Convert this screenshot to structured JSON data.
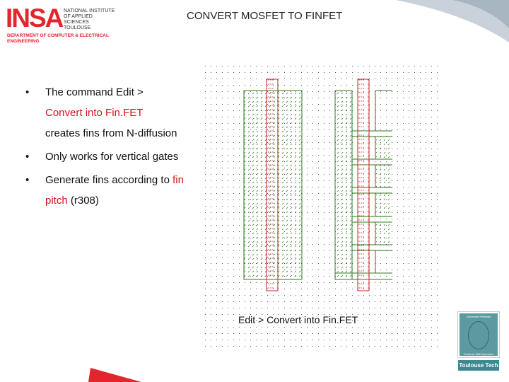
{
  "slide": {
    "title": "CONVERT MOSFET TO FINFET"
  },
  "logo": {
    "name": "INSA",
    "subtitle": [
      "NATIONAL INSTITUTE",
      "OF APPLIED",
      "SCIENCES",
      "TOULOUSE"
    ],
    "department": [
      "DEPARTMENT OF COMPUTER & ELECTRICAL",
      "ENGINEERING"
    ]
  },
  "bullets": [
    {
      "pre": "The command Edit >",
      "red": "Convert into Fin.FET",
      "post": "creates fins from N-diffusion"
    },
    {
      "pre": "Only works for vertical gates"
    },
    {
      "pre": "Generate fins according to ",
      "red": "fin pitch",
      "post": " (r308)"
    }
  ],
  "diagram": {
    "caption": "Edit > Convert into Fin.FET",
    "colors": {
      "diffusion": "#2e7a1e",
      "gate": "#c8262a",
      "grid": "#333333"
    }
  },
  "partner_logo": {
    "text_top": "Université Fédérale",
    "text_bottom": "Toulouse Midi-Pyrénées",
    "button": "Toulouse Tech"
  },
  "colors": {
    "accent": "#e3262e",
    "teal": "#3f8891"
  }
}
